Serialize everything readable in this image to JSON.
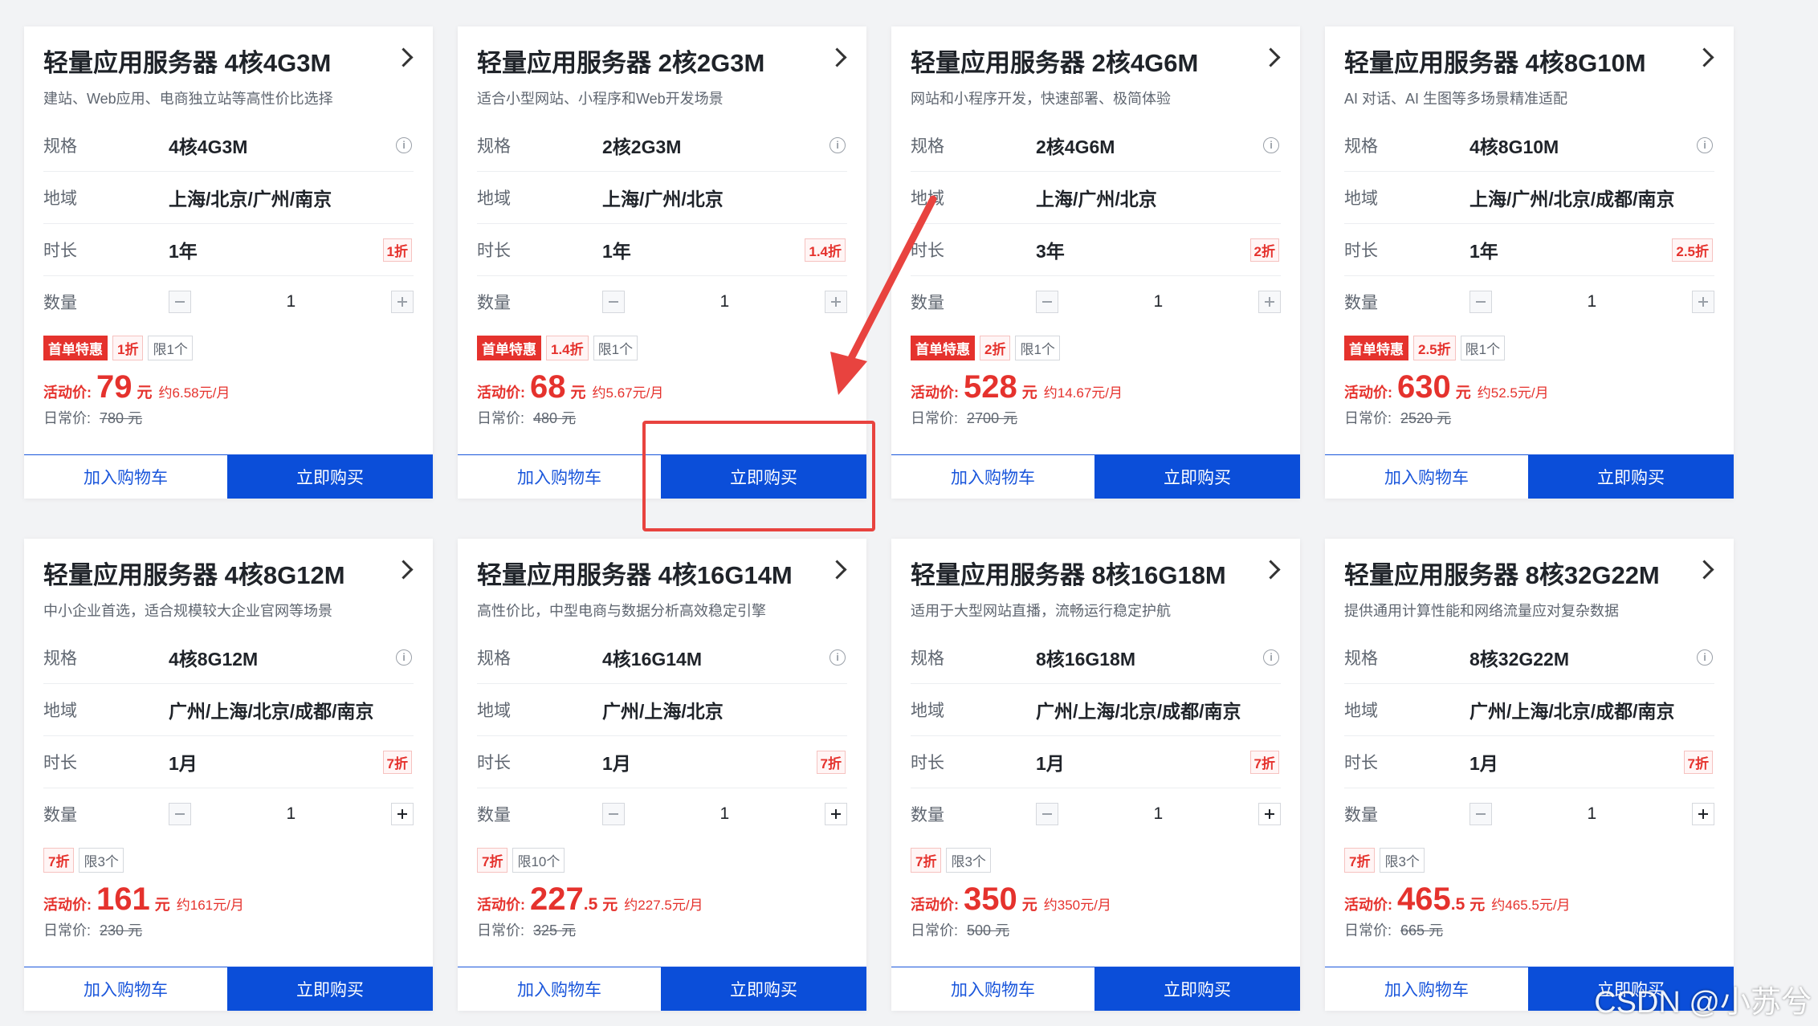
{
  "labels": {
    "spec": "规格",
    "region": "地域",
    "duration": "时长",
    "quantity": "数量",
    "promo_price": "活动价:",
    "orig_price": "日常价:",
    "yuan": "元",
    "add_cart": "加入购物车",
    "buy_now": "立即购买"
  },
  "cards": [
    {
      "title": "轻量应用服务器 4核4G3M",
      "subtitle": "建站、Web应用、电商独立站等高性价比选择",
      "spec": "4核4G3M",
      "region": "上海/北京/广州/南京",
      "duration": "1年",
      "discount": "1折",
      "qty": "1",
      "tag_first": "首单特惠",
      "tag_disc": "1折",
      "tag_limit": "限1个",
      "price": "79",
      "price_dec": "",
      "monthly": "约6.58元/月",
      "orig": "780 元"
    },
    {
      "title": "轻量应用服务器 2核2G3M",
      "subtitle": "适合小型网站、小程序和Web开发场景",
      "spec": "2核2G3M",
      "region": "上海/广州/北京",
      "duration": "1年",
      "discount": "1.4折",
      "qty": "1",
      "tag_first": "首单特惠",
      "tag_disc": "1.4折",
      "tag_limit": "限1个",
      "price": "68",
      "price_dec": "",
      "monthly": "约5.67元/月",
      "orig": "480 元"
    },
    {
      "title": "轻量应用服务器 2核4G6M",
      "subtitle": "网站和小程序开发，快速部署、极简体验",
      "spec": "2核4G6M",
      "region": "上海/广州/北京",
      "duration": "3年",
      "discount": "2折",
      "qty": "1",
      "tag_first": "首单特惠",
      "tag_disc": "2折",
      "tag_limit": "限1个",
      "price": "528",
      "price_dec": "",
      "monthly": "约14.67元/月",
      "orig": "2700 元"
    },
    {
      "title": "轻量应用服务器 4核8G10M",
      "subtitle": "AI 对话、AI 生图等多场景精准适配",
      "spec": "4核8G10M",
      "region": "上海/广州/北京/成都/南京",
      "duration": "1年",
      "discount": "2.5折",
      "qty": "1",
      "tag_first": "首单特惠",
      "tag_disc": "2.5折",
      "tag_limit": "限1个",
      "price": "630",
      "price_dec": "",
      "monthly": "约52.5元/月",
      "orig": "2520 元"
    },
    {
      "title": "轻量应用服务器 4核8G12M",
      "subtitle": "中小企业首选，适合规模较大企业官网等场景",
      "spec": "4核8G12M",
      "region": "广州/上海/北京/成都/南京",
      "duration": "1月",
      "discount": "7折",
      "qty": "1",
      "tag_first": "",
      "tag_disc": "7折",
      "tag_limit": "限3个",
      "price": "161",
      "price_dec": "",
      "monthly": "约161元/月",
      "orig": "230 元"
    },
    {
      "title": "轻量应用服务器 4核16G14M",
      "subtitle": "高性价比，中型电商与数据分析高效稳定引擎",
      "spec": "4核16G14M",
      "region": "广州/上海/北京",
      "duration": "1月",
      "discount": "7折",
      "qty": "1",
      "tag_first": "",
      "tag_disc": "7折",
      "tag_limit": "限10个",
      "price": "227",
      "price_dec": ".5",
      "monthly": "约227.5元/月",
      "orig": "325 元"
    },
    {
      "title": "轻量应用服务器 8核16G18M",
      "subtitle": "适用于大型网站直播，流畅运行稳定护航",
      "spec": "8核16G18M",
      "region": "广州/上海/北京/成都/南京",
      "duration": "1月",
      "discount": "7折",
      "qty": "1",
      "tag_first": "",
      "tag_disc": "7折",
      "tag_limit": "限3个",
      "price": "350",
      "price_dec": "",
      "monthly": "约350元/月",
      "orig": "500 元"
    },
    {
      "title": "轻量应用服务器 8核32G22M",
      "subtitle": "提供通用计算性能和网络流量应对复杂数据",
      "spec": "8核32G22M",
      "region": "广州/上海/北京/成都/南京",
      "duration": "1月",
      "discount": "7折",
      "qty": "1",
      "tag_first": "",
      "tag_disc": "7折",
      "tag_limit": "限3个",
      "price": "465",
      "price_dec": ".5",
      "monthly": "约465.5元/月",
      "orig": "665 元"
    }
  ],
  "watermark": "CSDN @小苏兮",
  "colors": {
    "accent": "#0b4ed9",
    "price_red": "#e5322d",
    "annotation": "#e8433f"
  }
}
